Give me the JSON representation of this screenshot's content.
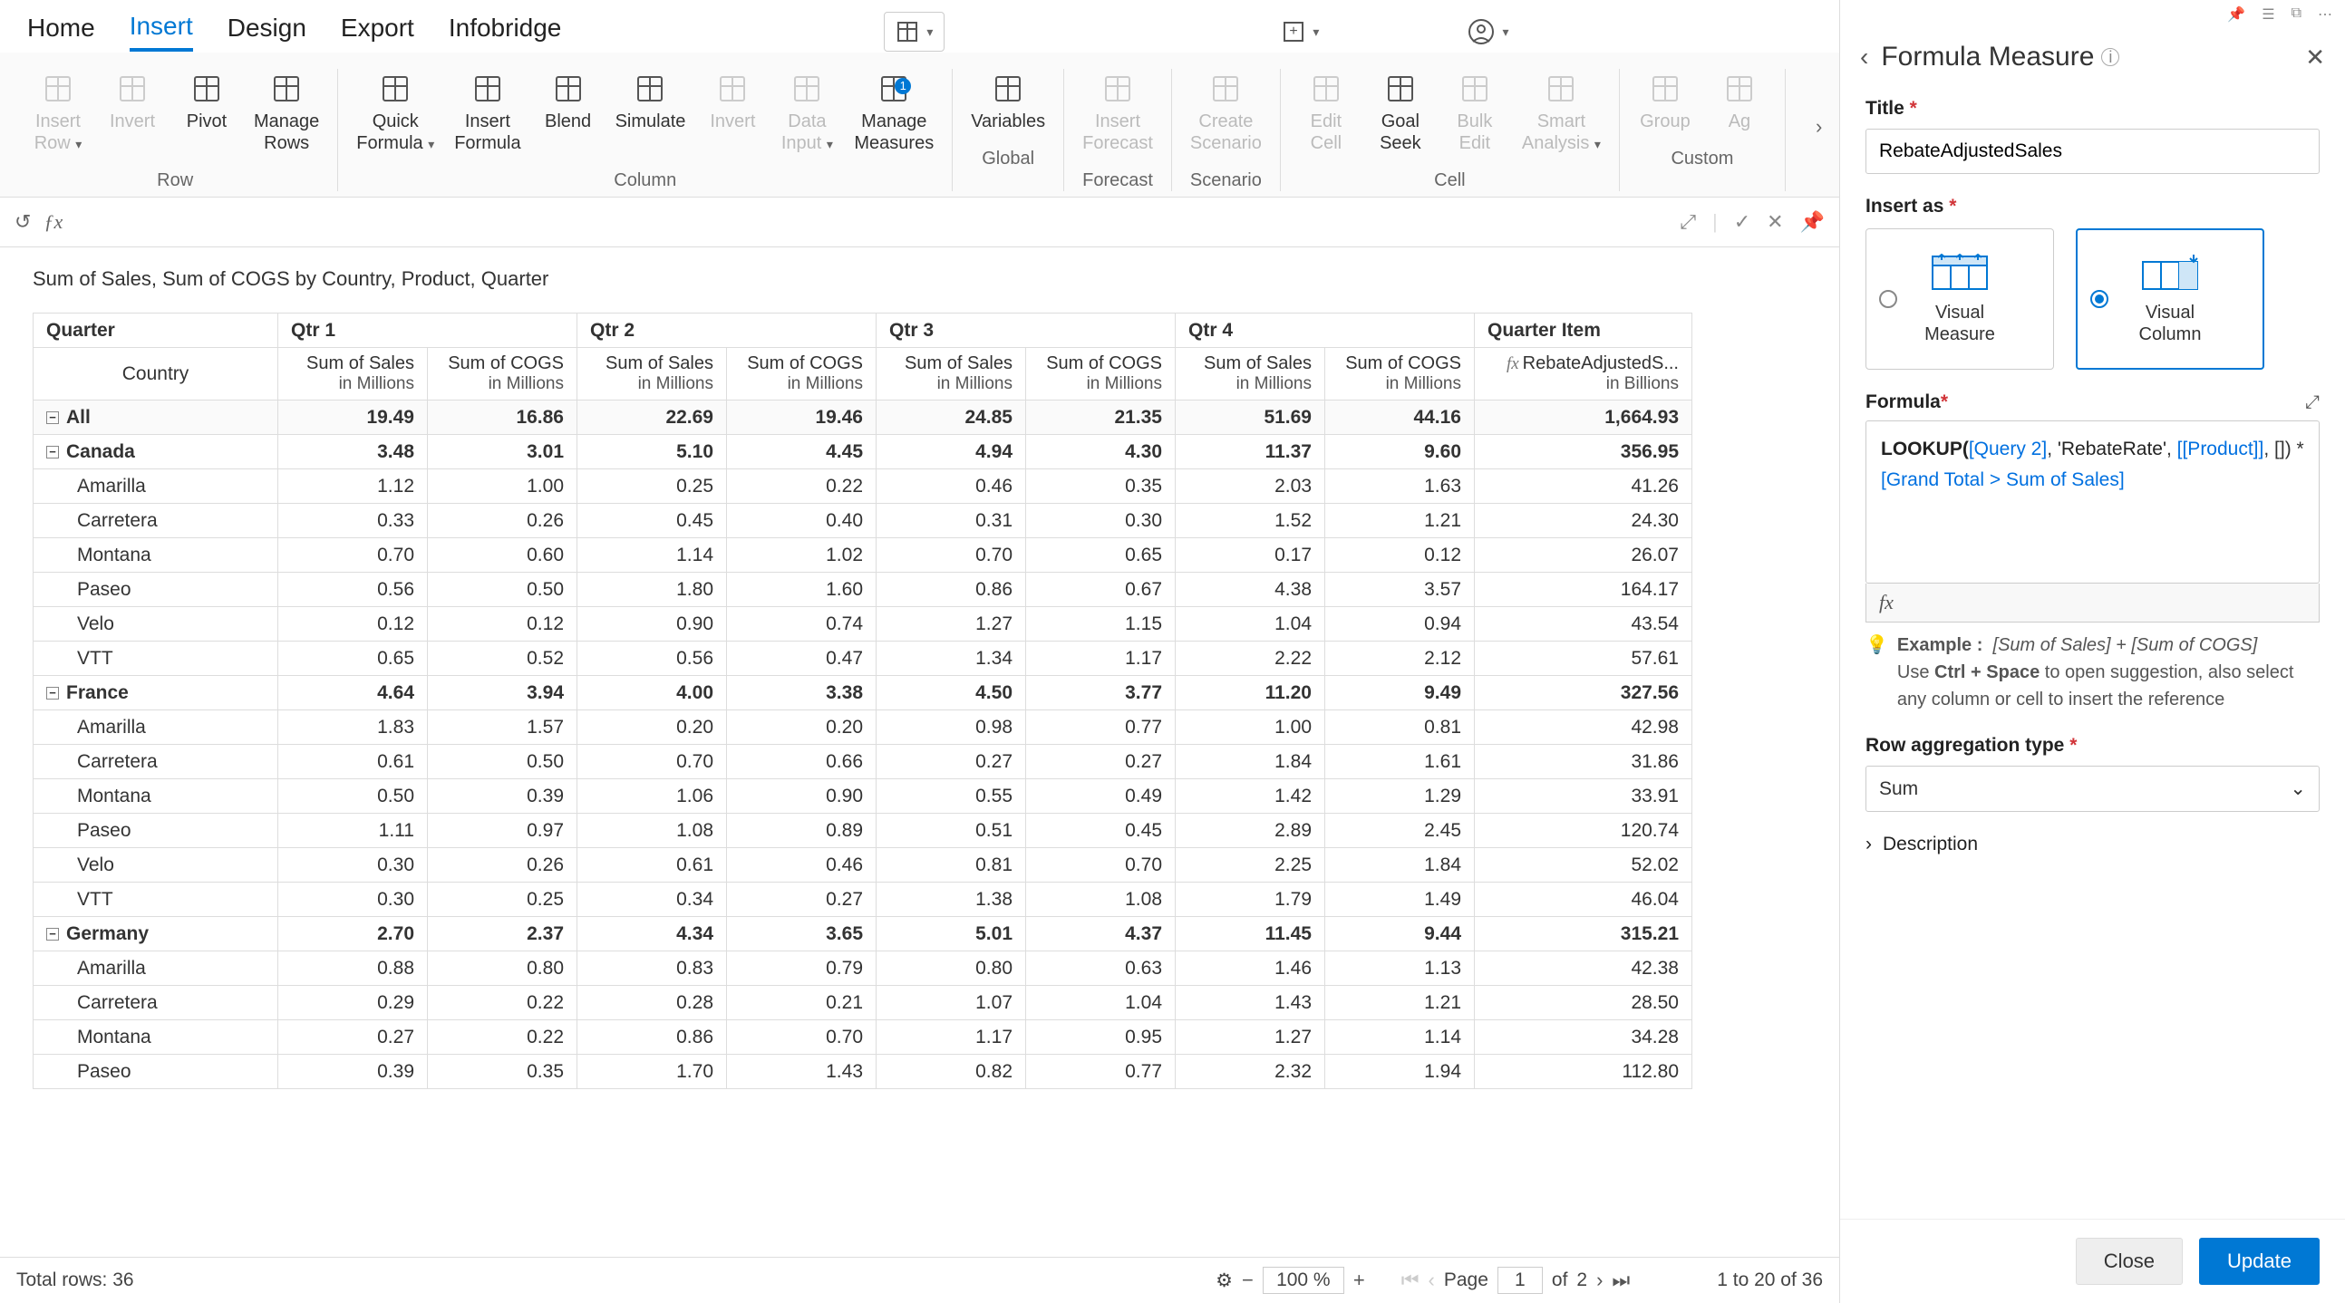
{
  "top_tabs": {
    "home": "Home",
    "insert": "Insert",
    "design": "Design",
    "export": "Export",
    "infobridge": "Infobridge",
    "active": "insert"
  },
  "ribbon": {
    "groups": [
      {
        "label": "Row",
        "items": [
          {
            "id": "insert-row",
            "label": "Insert\nRow",
            "chev": true,
            "disabled": true
          },
          {
            "id": "invert-row",
            "label": "Invert",
            "disabled": true
          },
          {
            "id": "pivot",
            "label": "Pivot"
          },
          {
            "id": "manage-rows",
            "label": "Manage\nRows"
          }
        ]
      },
      {
        "label": "Column",
        "items": [
          {
            "id": "quick-formula",
            "label": "Quick\nFormula",
            "chev": true
          },
          {
            "id": "insert-formula",
            "label": "Insert\nFormula"
          },
          {
            "id": "blend",
            "label": "Blend"
          },
          {
            "id": "simulate",
            "label": "Simulate"
          },
          {
            "id": "invert-col",
            "label": "Invert",
            "disabled": true
          },
          {
            "id": "data-input",
            "label": "Data\nInput",
            "chev": true,
            "disabled": true
          },
          {
            "id": "manage-measures",
            "label": "Manage\nMeasures",
            "badge": "1"
          }
        ]
      },
      {
        "label": "Global",
        "items": [
          {
            "id": "variables",
            "label": "Variables"
          }
        ]
      },
      {
        "label": "Forecast",
        "items": [
          {
            "id": "insert-forecast",
            "label": "Insert\nForecast",
            "disabled": true
          }
        ]
      },
      {
        "label": "Scenario",
        "items": [
          {
            "id": "create-scenario",
            "label": "Create\nScenario",
            "disabled": true
          }
        ]
      },
      {
        "label": "Cell",
        "items": [
          {
            "id": "edit-cell",
            "label": "Edit\nCell",
            "disabled": true
          },
          {
            "id": "goal-seek",
            "label": "Goal\nSeek"
          },
          {
            "id": "bulk-edit",
            "label": "Bulk\nEdit",
            "disabled": true
          },
          {
            "id": "smart-analysis",
            "label": "Smart\nAnalysis",
            "chev": true,
            "disabled": true
          }
        ]
      },
      {
        "label": "Custom",
        "items": [
          {
            "id": "group",
            "label": "Group",
            "disabled": true
          },
          {
            "id": "aggregate",
            "label": "Ag",
            "disabled": true
          }
        ]
      }
    ]
  },
  "sheet": {
    "title": "Sum of Sales, Sum of COGS by Country, Product, Quarter",
    "dim_row_label": "Quarter",
    "dim_col_label": "Country",
    "quarters": [
      "Qtr 1",
      "Qtr 2",
      "Qtr 3",
      "Qtr 4",
      "Quarter Item"
    ],
    "measures": [
      {
        "name": "Sum of Sales",
        "unit": "in Millions"
      },
      {
        "name": "Sum of COGS",
        "unit": "in Millions"
      }
    ],
    "final_measure": {
      "prefix": "fx",
      "name": "RebateAdjustedS...",
      "unit": "in Billions"
    },
    "rows": [
      {
        "type": "all",
        "label": "All",
        "vals": [
          "19.49",
          "16.86",
          "22.69",
          "19.46",
          "24.85",
          "21.35",
          "51.69",
          "44.16",
          "1,664.93"
        ]
      },
      {
        "type": "group",
        "label": "Canada",
        "vals": [
          "3.48",
          "3.01",
          "5.10",
          "4.45",
          "4.94",
          "4.30",
          "11.37",
          "9.60",
          "356.95"
        ]
      },
      {
        "type": "sub",
        "label": "Amarilla",
        "vals": [
          "1.12",
          "1.00",
          "0.25",
          "0.22",
          "0.46",
          "0.35",
          "2.03",
          "1.63",
          "41.26"
        ]
      },
      {
        "type": "sub",
        "label": "Carretera",
        "vals": [
          "0.33",
          "0.26",
          "0.45",
          "0.40",
          "0.31",
          "0.30",
          "1.52",
          "1.21",
          "24.30"
        ]
      },
      {
        "type": "sub",
        "label": "Montana",
        "vals": [
          "0.70",
          "0.60",
          "1.14",
          "1.02",
          "0.70",
          "0.65",
          "0.17",
          "0.12",
          "26.07"
        ]
      },
      {
        "type": "sub",
        "label": "Paseo",
        "vals": [
          "0.56",
          "0.50",
          "1.80",
          "1.60",
          "0.86",
          "0.67",
          "4.38",
          "3.57",
          "164.17"
        ]
      },
      {
        "type": "sub",
        "label": "Velo",
        "vals": [
          "0.12",
          "0.12",
          "0.90",
          "0.74",
          "1.27",
          "1.15",
          "1.04",
          "0.94",
          "43.54"
        ]
      },
      {
        "type": "sub",
        "label": "VTT",
        "vals": [
          "0.65",
          "0.52",
          "0.56",
          "0.47",
          "1.34",
          "1.17",
          "2.22",
          "2.12",
          "57.61"
        ]
      },
      {
        "type": "group",
        "label": "France",
        "vals": [
          "4.64",
          "3.94",
          "4.00",
          "3.38",
          "4.50",
          "3.77",
          "11.20",
          "9.49",
          "327.56"
        ]
      },
      {
        "type": "sub",
        "label": "Amarilla",
        "vals": [
          "1.83",
          "1.57",
          "0.20",
          "0.20",
          "0.98",
          "0.77",
          "1.00",
          "0.81",
          "42.98"
        ]
      },
      {
        "type": "sub",
        "label": "Carretera",
        "vals": [
          "0.61",
          "0.50",
          "0.70",
          "0.66",
          "0.27",
          "0.27",
          "1.84",
          "1.61",
          "31.86"
        ]
      },
      {
        "type": "sub",
        "label": "Montana",
        "vals": [
          "0.50",
          "0.39",
          "1.06",
          "0.90",
          "0.55",
          "0.49",
          "1.42",
          "1.29",
          "33.91"
        ]
      },
      {
        "type": "sub",
        "label": "Paseo",
        "vals": [
          "1.11",
          "0.97",
          "1.08",
          "0.89",
          "0.51",
          "0.45",
          "2.89",
          "2.45",
          "120.74"
        ]
      },
      {
        "type": "sub",
        "label": "Velo",
        "vals": [
          "0.30",
          "0.26",
          "0.61",
          "0.46",
          "0.81",
          "0.70",
          "2.25",
          "1.84",
          "52.02"
        ]
      },
      {
        "type": "sub",
        "label": "VTT",
        "vals": [
          "0.30",
          "0.25",
          "0.34",
          "0.27",
          "1.38",
          "1.08",
          "1.79",
          "1.49",
          "46.04"
        ]
      },
      {
        "type": "group",
        "label": "Germany",
        "vals": [
          "2.70",
          "2.37",
          "4.34",
          "3.65",
          "5.01",
          "4.37",
          "11.45",
          "9.44",
          "315.21"
        ]
      },
      {
        "type": "sub",
        "label": "Amarilla",
        "vals": [
          "0.88",
          "0.80",
          "0.83",
          "0.79",
          "0.80",
          "0.63",
          "1.46",
          "1.13",
          "42.38"
        ]
      },
      {
        "type": "sub",
        "label": "Carretera",
        "vals": [
          "0.29",
          "0.22",
          "0.28",
          "0.21",
          "1.07",
          "1.04",
          "1.43",
          "1.21",
          "28.50"
        ]
      },
      {
        "type": "sub",
        "label": "Montana",
        "vals": [
          "0.27",
          "0.22",
          "0.86",
          "0.70",
          "1.17",
          "0.95",
          "1.27",
          "1.14",
          "34.28"
        ]
      },
      {
        "type": "sub",
        "label": "Paseo",
        "vals": [
          "0.39",
          "0.35",
          "1.70",
          "1.43",
          "0.82",
          "0.77",
          "2.32",
          "1.94",
          "112.80"
        ]
      }
    ]
  },
  "status": {
    "total_rows_label": "Total rows:",
    "total_rows": "36",
    "zoom": "100 %",
    "page_label": "Page",
    "page_current": "1",
    "page_of_label": "of",
    "page_total": "2",
    "range_label": "1 to 20 of 36"
  },
  "panel": {
    "title": "Formula Measure",
    "fields": {
      "title_label": "Title",
      "title_value": "RebateAdjustedSales",
      "insert_as_label": "Insert as",
      "card_measure": "Visual\nMeasure",
      "card_column": "Visual\nColumn",
      "selected_card": "column",
      "formula_label": "Formula",
      "formula_tokens": [
        {
          "t": "fn",
          "v": "LOOKUP("
        },
        {
          "t": "ref",
          "v": "[Query 2]"
        },
        {
          "t": "txt",
          "v": ", "
        },
        {
          "t": "str",
          "v": "'RebateRate'"
        },
        {
          "t": "txt",
          "v": ", "
        },
        {
          "t": "ref",
          "v": "[[Product]]"
        },
        {
          "t": "txt",
          "v": ", []) * "
        },
        {
          "t": "ref",
          "v": "[Grand Total > Sum of  Sales]"
        }
      ],
      "fx_label": "fx",
      "hint_example_label": "Example :",
      "hint_example_value": "[Sum of Sales] + [Sum of COGS]",
      "hint_line2a": "Use ",
      "hint_ctrl": "Ctrl + Space",
      "hint_line2b": " to open suggestion, also select any column or cell to insert the reference",
      "agg_label": "Row aggregation type",
      "agg_value": "Sum",
      "desc_label": "Description"
    },
    "buttons": {
      "close": "Close",
      "update": "Update"
    }
  }
}
